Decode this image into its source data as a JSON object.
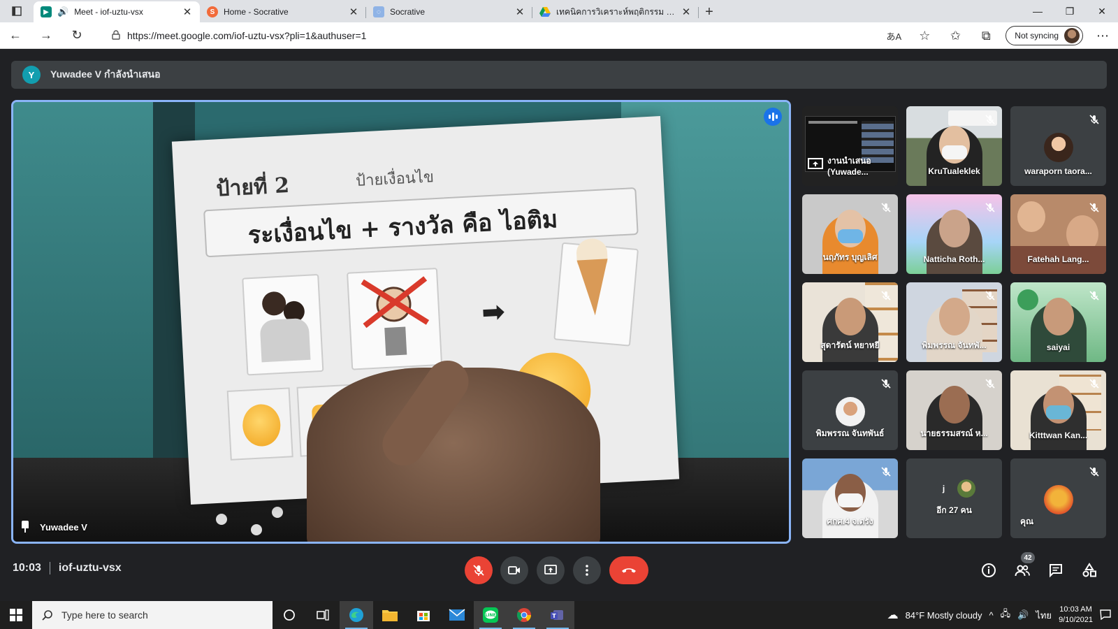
{
  "browser": {
    "tabs": [
      {
        "title": "Meet - iof-uztu-vsx",
        "active": true,
        "favicon": "meet-icon"
      },
      {
        "title": "Home - Socrative",
        "active": false,
        "favicon": "socrative-s-icon"
      },
      {
        "title": "Socrative",
        "active": false,
        "favicon": "socrative-icon"
      },
      {
        "title": "เทคนิคการวิเคราะห์พฤติกรรม - Goog",
        "active": false,
        "favicon": "google-drive-icon"
      }
    ],
    "url": "https://meet.google.com/iof-uztu-vsx?pli=1&authuser=1",
    "sync_label": "Not syncing"
  },
  "meet": {
    "presenter_initial": "Y",
    "presenting_text": "Yuwadee V กำลังนำเสนอ",
    "main_speaker": "Yuwadee V",
    "board": {
      "title": "ป้ายที่ 2",
      "subtitle": "ป้ายเงื่อนไข",
      "formula": "ระเงื่อนไข + รางวัล คือ ไอติม"
    },
    "participants": [
      {
        "name": "งานนำเสนอ (Yuwade...",
        "type": "presentation",
        "muted": false
      },
      {
        "name": "KruTualeklek",
        "type": "video",
        "muted": true
      },
      {
        "name": "waraporn taora...",
        "type": "avatar",
        "muted": true
      },
      {
        "name": "นฤภัทร บุญเลิศ",
        "type": "video",
        "muted": true
      },
      {
        "name": "Natticha Roth...",
        "type": "video",
        "muted": true
      },
      {
        "name": "Fatehah Lang...",
        "type": "video",
        "muted": true
      },
      {
        "name": "สุดารัตน์ หยาหยี",
        "type": "video",
        "muted": true
      },
      {
        "name": "พิมพรรณ จันทพั...",
        "type": "video",
        "muted": true
      },
      {
        "name": "saiyai",
        "type": "video",
        "muted": true
      },
      {
        "name": "พิมพรรณ จันทพันธ์",
        "type": "avatar",
        "muted": true
      },
      {
        "name": "นายธรรมสรณ์ ห...",
        "type": "video",
        "muted": true
      },
      {
        "name": "Kitttwan Kan...",
        "type": "video",
        "muted": true
      },
      {
        "name": "ศกศ.4 จ.ตรัง",
        "type": "video",
        "muted": true
      },
      {
        "name": "อีก 27 คน",
        "type": "more",
        "muted": false,
        "initial": "j"
      },
      {
        "name": "คุณ",
        "type": "avatar",
        "muted": true
      }
    ],
    "time": "10:03",
    "meeting_code": "iof-uztu-vsx",
    "participant_count": "42"
  },
  "taskbar": {
    "search_placeholder": "Type here to search",
    "weather": "84°F  Mostly cloudy",
    "language": "ไทย",
    "clock_time": "10:03 AM",
    "clock_date": "9/10/2021"
  },
  "colors": {
    "meet_bg": "#202124",
    "end_call_red": "#ea4335",
    "active_blue": "#8ab4f8"
  }
}
